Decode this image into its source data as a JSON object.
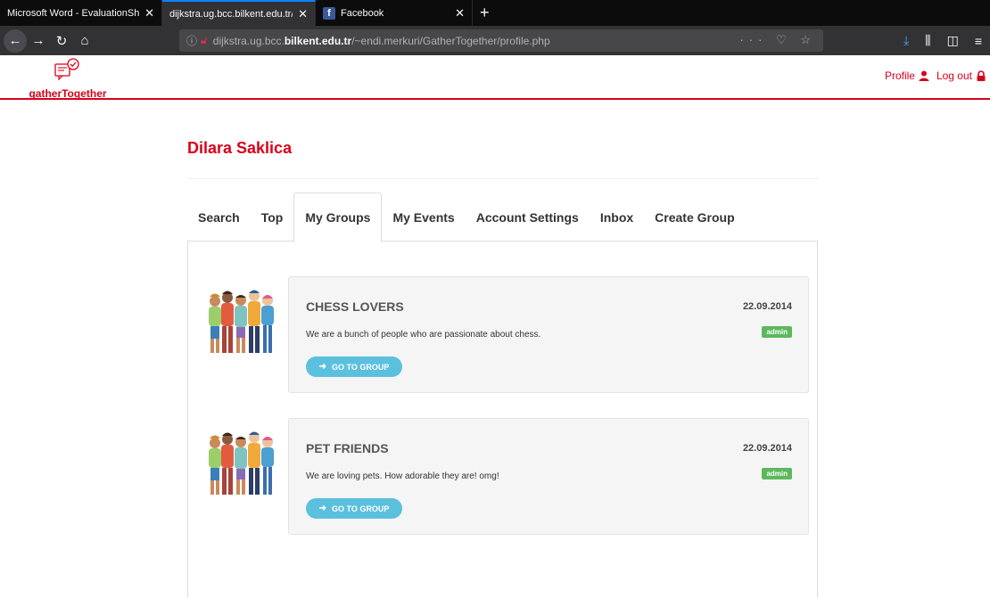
{
  "browser": {
    "tabs": [
      {
        "title": "Microsoft Word - EvaluationSheet.",
        "close": "✕"
      },
      {
        "title": "dijkstra.ug.bcc.bilkent.edu.tr/~endi",
        "close": "✕"
      },
      {
        "title": "Facebook",
        "close": "✕"
      }
    ],
    "new_tab": "+",
    "url_prefix": "dijkstra.ug.bcc.",
    "url_host": "bilkent.edu.tr",
    "url_path": "/~endi.merkuri/GatherTogether/profile.php",
    "url_icons": "··· ♡ ☆"
  },
  "header": {
    "logo_text": "gatherTogether",
    "profile_label": "Profile",
    "logout_label": "Log out"
  },
  "profile": {
    "name": "Dilara Saklica"
  },
  "tabs": [
    {
      "label": "Search"
    },
    {
      "label": "Top"
    },
    {
      "label": "My Groups"
    },
    {
      "label": "My Events"
    },
    {
      "label": "Account Settings"
    },
    {
      "label": "Inbox"
    },
    {
      "label": "Create Group"
    }
  ],
  "active_tab": "My Groups",
  "groups": [
    {
      "title": "CHESS LOVERS",
      "date": "22.09.2014",
      "description": "We are a bunch of people who are passionate about chess.",
      "role": "admin",
      "button": "GO TO GROUP"
    },
    {
      "title": "PET FRIENDS",
      "date": "22.09.2014",
      "description": "We are loving pets. How adorable they are! omg!",
      "role": "admin",
      "button": "GO TO GROUP"
    }
  ],
  "colors": {
    "brand": "#d9001b",
    "button": "#5bc0de",
    "badge": "#5cb85c"
  }
}
